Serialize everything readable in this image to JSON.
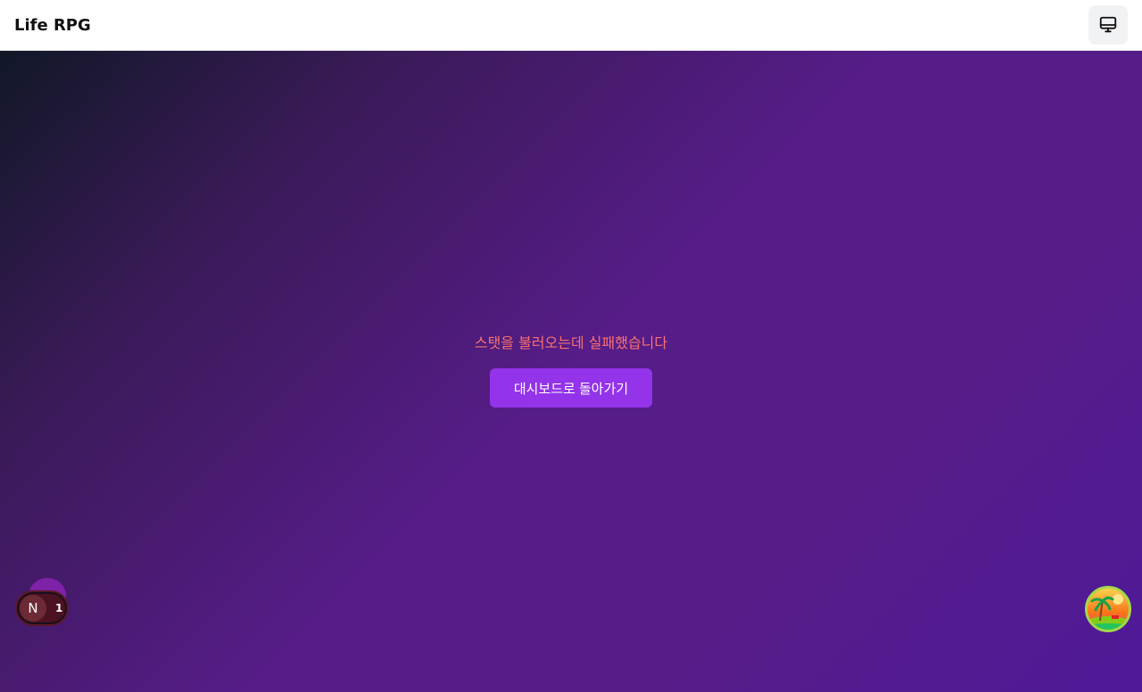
{
  "header": {
    "title": "Life RPG",
    "device_icon": "monitor-icon"
  },
  "main": {
    "error_message": "스탯을 불러오는데 실패했습니다",
    "back_button_label": "대시보드로 돌아가기"
  },
  "dev_indicator": {
    "letter": "N",
    "issue_count": "1"
  },
  "avatar": {
    "icon": "island-avatar-icon"
  },
  "colors": {
    "accent": "#9333ea",
    "error": "#f87171"
  }
}
